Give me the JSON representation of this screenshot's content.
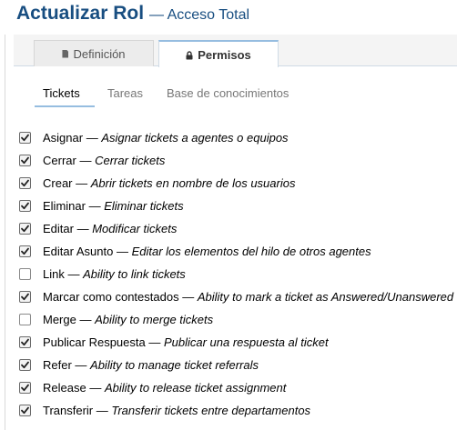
{
  "header": {
    "title": "Actualizar Rol",
    "subtitle": "— Acceso Total"
  },
  "tabs": [
    {
      "label": "Definición",
      "icon": "document-icon",
      "active": false
    },
    {
      "label": "Permisos",
      "icon": "lock-icon",
      "active": true
    }
  ],
  "subtabs": [
    {
      "label": "Tickets",
      "active": true
    },
    {
      "label": "Tareas",
      "active": false
    },
    {
      "label": "Base de conocimientos",
      "active": false
    }
  ],
  "permissions": [
    {
      "name": "Asignar",
      "sep": " — ",
      "desc": "Asignar tickets a agentes o equipos",
      "checked": true
    },
    {
      "name": "Cerrar",
      "sep": " — ",
      "desc": "Cerrar tickets",
      "checked": true
    },
    {
      "name": "Crear",
      "sep": " — ",
      "desc": "Abrir tickets en nombre de los usuarios",
      "checked": true
    },
    {
      "name": "Eliminar",
      "sep": " — ",
      "desc": "Eliminar tickets",
      "checked": true
    },
    {
      "name": "Editar",
      "sep": " — ",
      "desc": "Modificar tickets",
      "checked": true
    },
    {
      "name": "Editar Asunto",
      "sep": " — ",
      "desc": "Editar los elementos del hilo de otros agentes",
      "checked": true
    },
    {
      "name": "Link",
      "sep": " — ",
      "desc": "Ability to link tickets",
      "checked": false
    },
    {
      "name": "Marcar como contestados",
      "sep": " — ",
      "desc": "Ability to mark a ticket as Answered/Unanswered",
      "checked": true
    },
    {
      "name": "Merge",
      "sep": " — ",
      "desc": "Ability to merge tickets",
      "checked": false
    },
    {
      "name": "Publicar Respuesta",
      "sep": " — ",
      "desc": "Publicar una respuesta al ticket",
      "checked": true
    },
    {
      "name": "Refer",
      "sep": " — ",
      "desc": "Ability to manage ticket referrals",
      "checked": true
    },
    {
      "name": "Release",
      "sep": " — ",
      "desc": "Ability to release ticket assignment",
      "checked": true
    },
    {
      "name": "Transferir",
      "sep": " — ",
      "desc": "Transferir tickets entre departamentos",
      "checked": true
    }
  ],
  "colors": {
    "title": "#184e81",
    "tab_accent": "#96bde0",
    "tab_border": "#cfdbe6"
  }
}
